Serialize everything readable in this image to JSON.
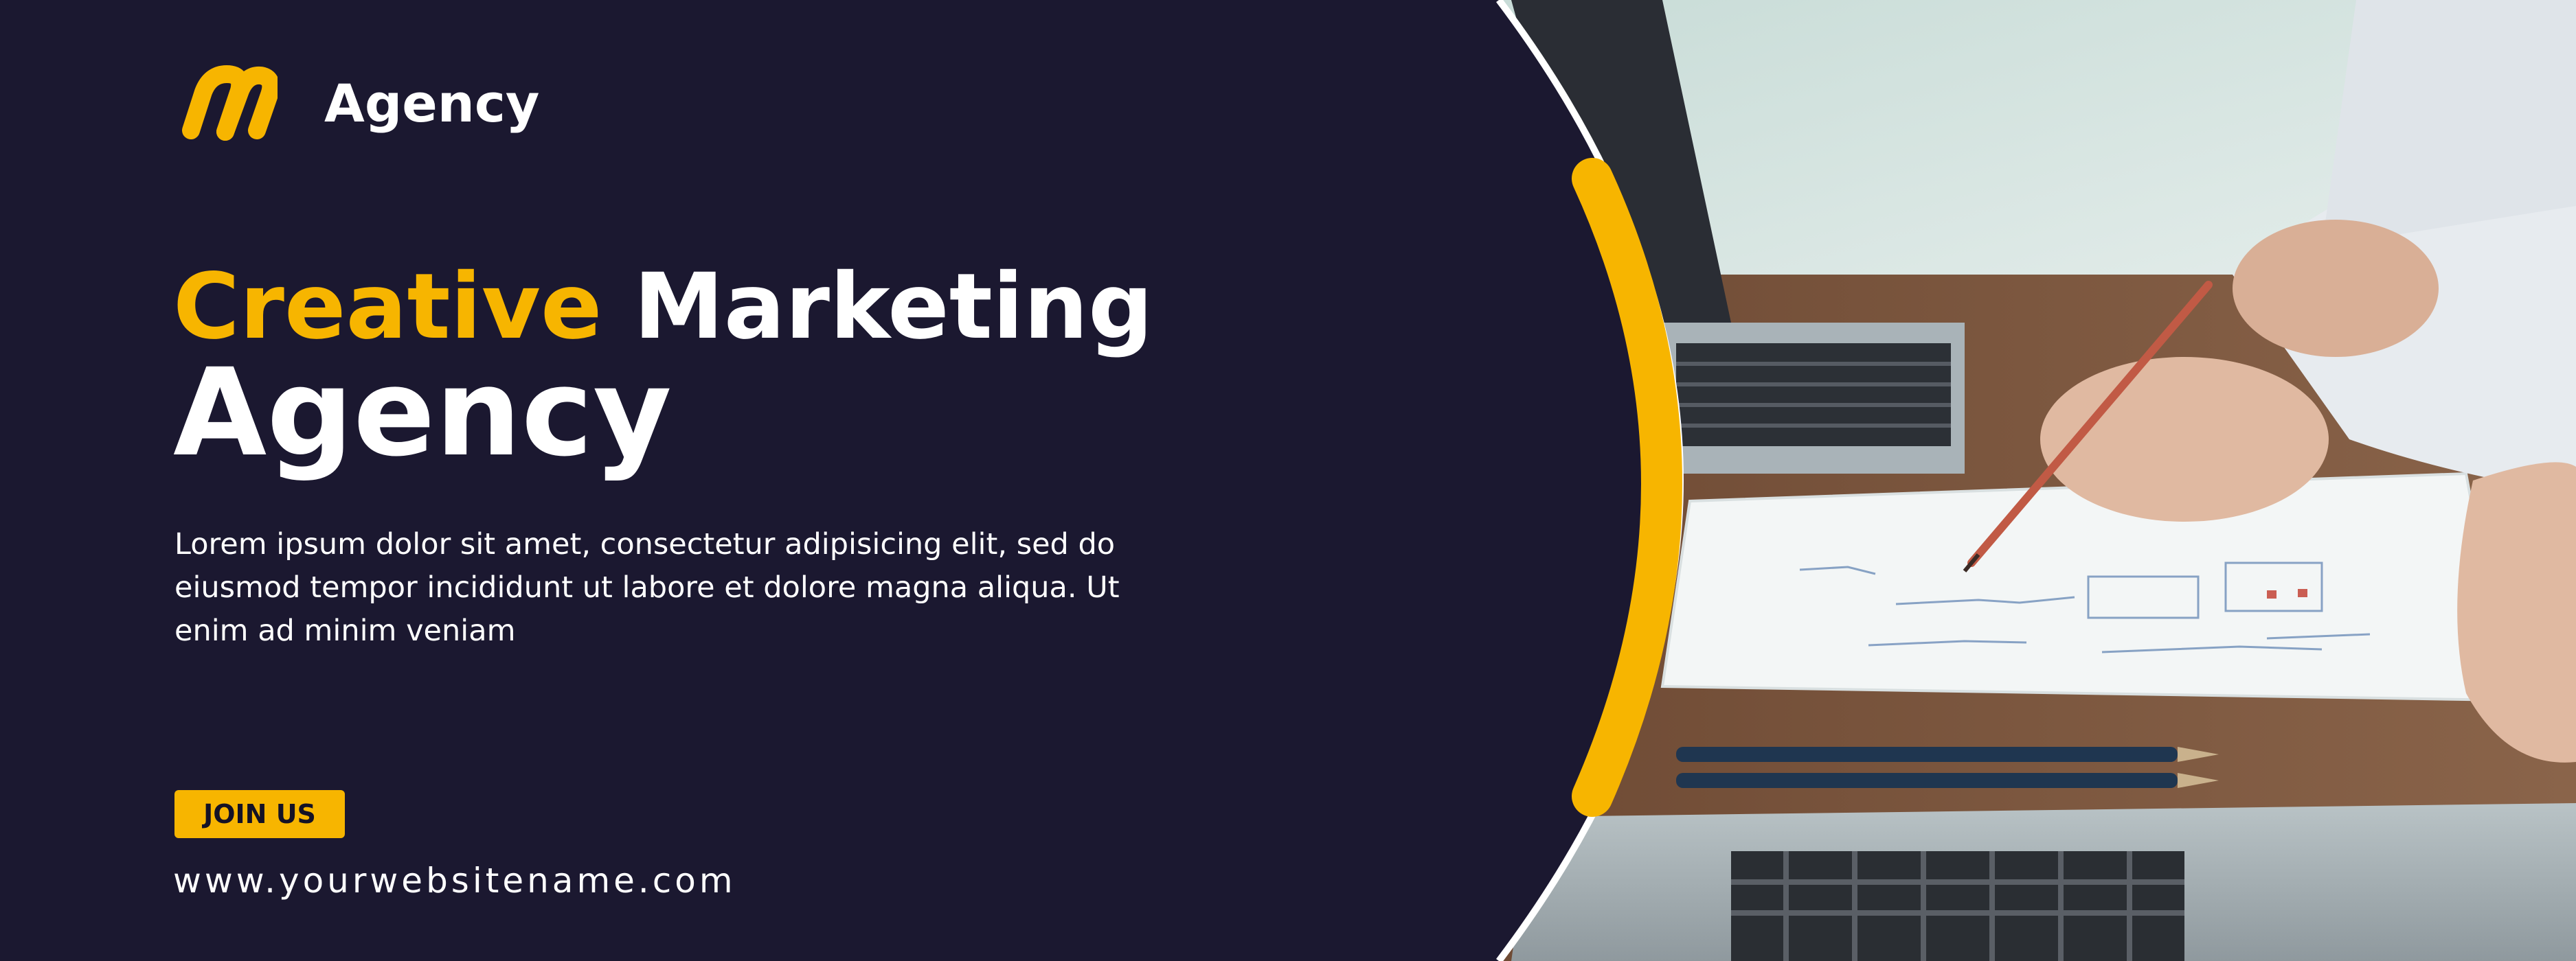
{
  "brand": {
    "name": "Agency"
  },
  "headline": {
    "accent_word": "Creative",
    "word2": "Marketing",
    "line2": "Agency"
  },
  "body": {
    "text": "Lorem ipsum dolor sit amet, consectetur adipisicing elit, sed do eiusmod tempor incididunt ut labore et dolore magna aliqua. Ut enim ad minim veniam"
  },
  "cta": {
    "label": "JOIN US"
  },
  "website": {
    "url": "www.yourwebsitename.com"
  },
  "icons": {
    "logo": "agency-logo-icon"
  },
  "colors": {
    "background": "#1b1830",
    "accent": "#f7b500",
    "text": "#ffffff"
  }
}
